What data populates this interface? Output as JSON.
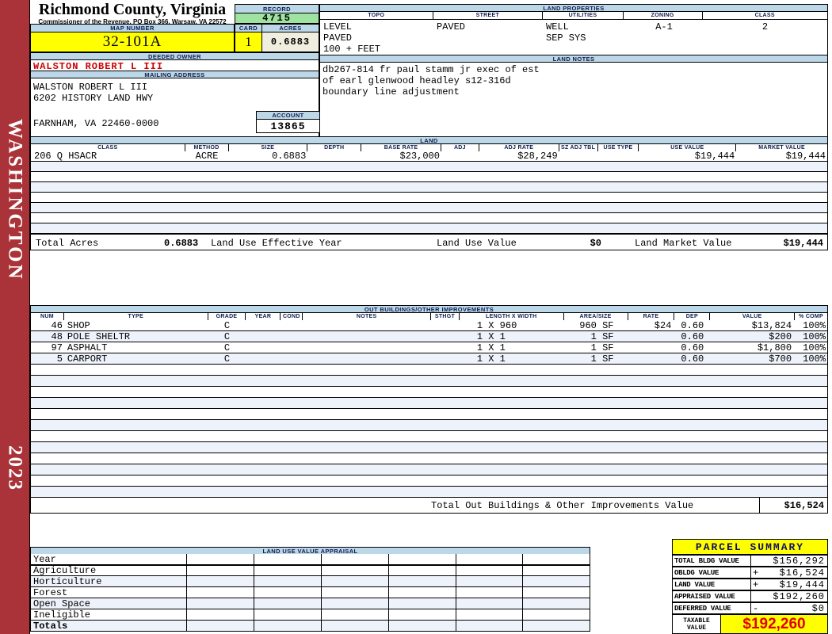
{
  "sidebar": {
    "county": "WASHINGTON",
    "year": "2023"
  },
  "header": {
    "title": "Richmond County, Virginia",
    "subtitle": "Commissioner of the Revenue, PO Box 366, Warsaw, VA 22572",
    "record_label": "RECORD",
    "record_value": "4715",
    "map_number_label": "MAP NUMBER",
    "map_number_value": "32-101A",
    "card_label": "CARD",
    "card_value": "1",
    "acres_label": "ACRES",
    "acres_value": "0.6883"
  },
  "land_properties": {
    "title": "LAND PROPERTIES",
    "columns": [
      "TOPO",
      "STREET",
      "UTILITIES",
      "ZONING",
      "CLASS"
    ],
    "topo_lines": [
      "LEVEL",
      "PAVED",
      "100 + FEET"
    ],
    "street": "PAVED",
    "utilities_lines": [
      "WELL",
      "SEP SYS"
    ],
    "zoning": "A-1",
    "class": "2"
  },
  "owner": {
    "deeded_owner_label": "DEEDED OWNER",
    "deeded_owner": "WALSTON ROBERT L III",
    "mailing_address_label": "MAILING ADDRESS",
    "address_lines": [
      "WALSTON ROBERT L III",
      "6202 HISTORY LAND HWY",
      "FARNHAM, VA 22460-0000"
    ],
    "account_label": "ACCOUNT",
    "account_value": "13865"
  },
  "land_notes": {
    "title": "LAND NOTES",
    "lines": [
      "db267-814 fr paul stamm jr exec of est",
      "of earl glenwood headley s12-316d",
      "boundary line adjustment"
    ]
  },
  "land_table": {
    "title": "LAND",
    "headers": [
      "CLASS",
      "METHOD",
      "SIZE",
      "DEPTH",
      "BASE RATE",
      "ADJ",
      "ADJ RATE",
      "SZ ADJ TBL",
      "USE TYPE",
      "USE VALUE",
      "MARKET VALUE"
    ],
    "rows": [
      [
        "206 Q HSACR",
        "ACRE",
        "0.6883",
        "",
        "$23,000",
        "",
        "$28,249",
        "",
        "",
        "$19,444",
        "$19,444"
      ]
    ],
    "empty_row_count": 7,
    "totals": {
      "total_acres_label": "Total Acres",
      "total_acres": "0.6883",
      "effective_year_label": "Land Use Effective Year",
      "use_value_label": "Land Use Value",
      "use_value": "$0",
      "market_value_label": "Land Market Value",
      "market_value": "$19,444"
    }
  },
  "out_buildings": {
    "title": "OUT BUILDINGS/OTHER IMPROVEMENTS",
    "headers": [
      "NUM",
      "TYPE",
      "GRADE",
      "YEAR",
      "COND",
      "NOTES",
      "STHGT",
      "LENGTH X WIDTH",
      "AREA/SIZE",
      "RATE",
      "DEP",
      "VALUE",
      "% COMP"
    ],
    "rows": [
      [
        "46",
        "SHOP",
        "C",
        "",
        "",
        "",
        "",
        "1 X 960",
        "960 SF",
        "$24",
        "0.60",
        "$13,824",
        "100%"
      ],
      [
        "48",
        "POLE SHELTR",
        "C",
        "",
        "",
        "",
        "",
        "1 X 1",
        "1 SF",
        "",
        "0.60",
        "$200",
        "100%"
      ],
      [
        "97",
        "ASPHALT",
        "C",
        "",
        "",
        "",
        "",
        "1 X 1",
        "1 SF",
        "",
        "0.60",
        "$1,800",
        "100%"
      ],
      [
        "5",
        "CARPORT",
        "C",
        "",
        "",
        "",
        "",
        "1 X 1",
        "1 SF",
        "",
        "0.60",
        "$700",
        "100%"
      ]
    ],
    "empty_row_count": 12,
    "total_label": "Total Out Buildings & Other Improvements Value",
    "total_value": "$16,524"
  },
  "land_use_appraisal": {
    "title": "LAND USE VALUE APPRAISAL",
    "row_labels": [
      "Year",
      "Agriculture",
      "Horticulture",
      "Forest",
      "Open Space",
      "Ineligible",
      "Totals"
    ],
    "value_column_count": 6
  },
  "parcel_summary": {
    "title": "PARCEL SUMMARY",
    "rows": [
      {
        "label": "TOTAL BLDG VALUE",
        "op": "",
        "value": "$156,292"
      },
      {
        "label": "OBLDG VALUE",
        "op": "+",
        "value": "$16,524"
      },
      {
        "label": "LAND VALUE",
        "op": "+",
        "value": "$19,444"
      },
      {
        "label": "APPRAISED VALUE",
        "op": "",
        "value": "$192,260"
      },
      {
        "label": "DEFERRED VALUE",
        "op": "-",
        "value": "$0"
      }
    ],
    "taxable_label_line1": "TAXABLE",
    "taxable_label_line2": "VALUE",
    "taxable_value": "$192,260"
  },
  "colors": {
    "sidebar_red": "#A93338",
    "band_blue": "#BCD7E8",
    "record_green": "#9FE3A0",
    "highlight_yellow": "#FFFF00",
    "acres_cream": "#F0EEDF",
    "alt_row": "#EEF2FA",
    "owner_red": "#CC0000",
    "taxable_red": "#E00000"
  }
}
